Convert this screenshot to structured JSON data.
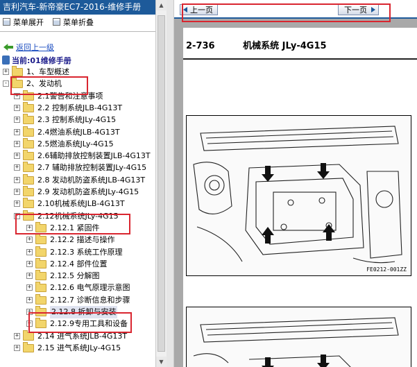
{
  "window": {
    "title": "吉利汽车-新帝豪EC7-2016-维修手册"
  },
  "menu": {
    "expand_label": "菜单展开",
    "collapse_label": "菜单折叠"
  },
  "back_link": "返回上一级",
  "current_label": "当前:01维修手册",
  "tree": [
    {
      "label": "1、车型概述",
      "level": 0,
      "expander": "+"
    },
    {
      "label": "2、发动机",
      "level": 0,
      "expander": "-",
      "open": true
    },
    {
      "label": "2.1警告和注意事项",
      "level": 1,
      "expander": "+"
    },
    {
      "label": "2.2 控制系统JLB-4G13T",
      "level": 1,
      "expander": "+"
    },
    {
      "label": "2.3 控制系统JLy-4G15",
      "level": 1,
      "expander": "+"
    },
    {
      "label": "2.4燃油系统JLB-4G13T",
      "level": 1,
      "expander": "+"
    },
    {
      "label": "2.5燃油系统JLy-4G15",
      "level": 1,
      "expander": "+"
    },
    {
      "label": "2.6辅助排放控制装置JLB-4G13T",
      "level": 1,
      "expander": "+"
    },
    {
      "label": "2.7 辅助排放控制装置JLy-4G15",
      "level": 1,
      "expander": "+"
    },
    {
      "label": "2.8 发动机防盗系统JLB-4G13T",
      "level": 1,
      "expander": "+"
    },
    {
      "label": "2.9 发动机防盗系统JLy-4G15",
      "level": 1,
      "expander": "+"
    },
    {
      "label": "2.10机械系统JLB-4G13T",
      "level": 1,
      "expander": "+"
    },
    {
      "label": "2.12机械系统JLy-4G15",
      "level": 1,
      "expander": "-",
      "open": true
    },
    {
      "label": "2.12.1 紧固件",
      "level": 2,
      "expander": "+"
    },
    {
      "label": "2.12.2 描述与操作",
      "level": 2,
      "expander": "+"
    },
    {
      "label": "2.12.3 系统工作原理",
      "level": 2,
      "expander": "+"
    },
    {
      "label": "2.12.4 部件位置",
      "level": 2,
      "expander": "+"
    },
    {
      "label": "2.12.5 分解图",
      "level": 2,
      "expander": "+"
    },
    {
      "label": "2.12.6 电气原理示意图",
      "level": 2,
      "expander": "+"
    },
    {
      "label": "2.12.7 诊断信息和步骤",
      "level": 2,
      "expander": "+"
    },
    {
      "label": "2.12.8 拆卸与安装",
      "level": 2,
      "expander": "+",
      "selected": true
    },
    {
      "label": "2.12.9专用工具和设备",
      "level": 2,
      "expander": "+"
    },
    {
      "label": "2.14 进气系统JLB-4G13T",
      "level": 1,
      "expander": "+"
    },
    {
      "label": "2.15 进气系统JLy-4G15",
      "level": 1,
      "expander": "+"
    }
  ],
  "nav": {
    "prev_label": "上一页",
    "next_label": "下一页"
  },
  "page": {
    "number": "2-736",
    "heading": "机械系统 JLy-4G15",
    "figure_code": "FE0212-001ZZ"
  },
  "colors": {
    "title_bar": "#1d5a9a",
    "highlight": "#d9252f",
    "selection": "#dfe3f0"
  }
}
